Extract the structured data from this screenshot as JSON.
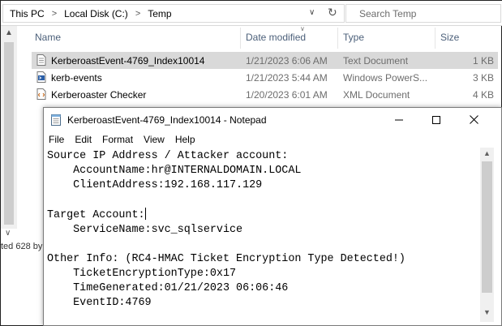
{
  "explorer": {
    "breadcrumb": [
      "This PC",
      "Local Disk (C:)",
      "Temp"
    ],
    "search_placeholder": "Search Temp",
    "columns": {
      "name": "Name",
      "date": "Date modified",
      "type": "Type",
      "size": "Size"
    },
    "files": [
      {
        "name": "KerberoastEvent-4769_Index10014",
        "date": "1/21/2023 6:06 AM",
        "type": "Text Document",
        "size": "1 KB",
        "icon": "text-file-icon",
        "selected": true
      },
      {
        "name": "kerb-events",
        "date": "1/21/2023 5:44 AM",
        "type": "Windows PowerS...",
        "size": "3 KB",
        "icon": "powershell-file-icon",
        "selected": false
      },
      {
        "name": "Kerberoaster Checker",
        "date": "1/20/2023 6:01 AM",
        "type": "XML Document",
        "size": "4 KB",
        "icon": "xml-file-icon",
        "selected": false
      }
    ],
    "status_partial": "ted  628 by"
  },
  "notepad": {
    "title": "KerberoastEvent-4769_Index10014 - Notepad",
    "menu": [
      "File",
      "Edit",
      "Format",
      "View",
      "Help"
    ],
    "lines": [
      "Source IP Address / Attacker account:",
      "    AccountName:hr@INTERNALDOMAIN.LOCAL",
      "    ClientAddress:192.168.117.129",
      "",
      "Target Account:",
      "    ServiceName:svc_sqlservice",
      "",
      "Other Info: (RC4-HMAC Ticket Encryption Type Detected!)",
      "    TicketEncryptionType:0x17",
      "    TimeGenerated:01/21/2023 06:06:46",
      "    EventID:4769"
    ]
  },
  "colors": {
    "selected_row": "#d9d9d9",
    "header_text": "#4c607a",
    "dim_text": "#6d6d6d"
  }
}
